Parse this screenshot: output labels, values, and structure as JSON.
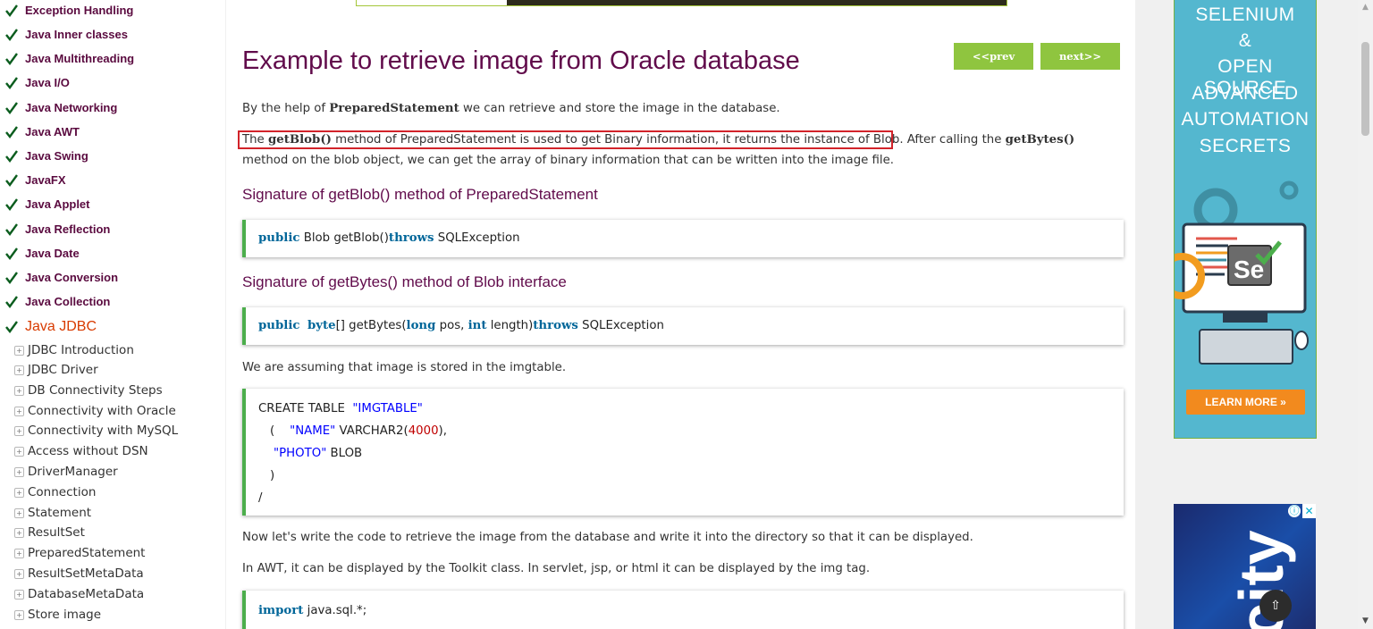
{
  "sidebar": {
    "topics": [
      {
        "label": "Exception Handling"
      },
      {
        "label": "Java Inner classes"
      },
      {
        "label": "Java Multithreading"
      },
      {
        "label": "Java I/O"
      },
      {
        "label": "Java Networking"
      },
      {
        "label": "Java AWT"
      },
      {
        "label": "Java Swing"
      },
      {
        "label": "JavaFX"
      },
      {
        "label": "Java Applet"
      },
      {
        "label": "Java Reflection"
      },
      {
        "label": "Java Date"
      },
      {
        "label": "Java Conversion"
      },
      {
        "label": "Java Collection"
      }
    ],
    "active_topic": "Java JDBC",
    "subitems": [
      {
        "label": "JDBC Introduction"
      },
      {
        "label": "JDBC Driver"
      },
      {
        "label": "DB Connectivity Steps"
      },
      {
        "label": "Connectivity with Oracle"
      },
      {
        "label": "Connectivity with MySQL"
      },
      {
        "label": "Access without DSN"
      },
      {
        "label": "DriverManager"
      },
      {
        "label": "Connection"
      },
      {
        "label": "Statement"
      },
      {
        "label": "ResultSet"
      },
      {
        "label": "PreparedStatement"
      },
      {
        "label": "ResultSetMetaData"
      },
      {
        "label": "DatabaseMetaData"
      },
      {
        "label": "Store image"
      }
    ]
  },
  "main": {
    "title": "Example to retrieve image from Oracle database",
    "prev_label": "<<prev",
    "next_label": "next>>",
    "intro": {
      "pre": "By the help of ",
      "bold": "PreparedStatement",
      "post": " we can retrieve and store the image in the database."
    },
    "para2": {
      "p1": "The ",
      "b1": "getBlob()",
      "p2": " method of PreparedStatement is used to get Binary information, it returns the instance of Blob.",
      "p3": " After calling the ",
      "b2": "getBytes()",
      "p4": " method on the blob object, we can get the array of binary information that can be written into the image file."
    },
    "heading1": "Signature of getBlob() method of PreparedStatement",
    "code1": {
      "kw1": "public",
      "t1": " Blob getBlob()",
      "kw2": "throws",
      "t2": " SQLException"
    },
    "heading2": "Signature of getBytes() method of Blob interface",
    "code2": {
      "kw1": "public",
      "kw2": "byte",
      "t1": "[] getBytes(",
      "kw3": "long",
      "t2": " pos, ",
      "kw4": "int",
      "t3": " length)",
      "kw5": "throws",
      "t4": " SQLException"
    },
    "assume_text": "We are assuming that image is stored in the imgtable.",
    "sql": {
      "l1a": "CREATE TABLE  ",
      "l1b": "\"IMGTABLE\"",
      "l2a": "(    ",
      "l2b": "\"NAME\"",
      "l2c": " VARCHAR2(",
      "l2d": "4000",
      "l2e": "),",
      "l3a": "\"PHOTO\"",
      "l3b": " BLOB",
      "l4": ")",
      "l5": "/"
    },
    "now_text": "Now let's write the code to retrieve the image from the database and write it into the directory so that it can be displayed.",
    "awt_text": "In AWT, it can be displayed by the Toolkit class. In servlet, jsp, or html it can be displayed by the img tag.",
    "code3": {
      "kw": "import",
      "t": " java.sql.*;"
    }
  },
  "ad1": {
    "lines": [
      "SELENIUM",
      "&",
      "OPEN SOURCE",
      "ADVANCED",
      "AUTOMATION",
      "SECRETS"
    ],
    "cta": "LEARN MORE »",
    "colors": {
      "bg": "#54b7cf",
      "cta": "#f28a1e"
    }
  },
  "ad2": {
    "text": "city",
    "info": "ⓘ",
    "close": "✕",
    "scroll_top": "⇧"
  },
  "colors": {
    "title": "#610b4b",
    "nav_button": "#8fc53f",
    "code_border": "#4cae4c",
    "keyword": "#006699",
    "highlight_box": "#d2232a",
    "active_topic": "#d83b01"
  }
}
